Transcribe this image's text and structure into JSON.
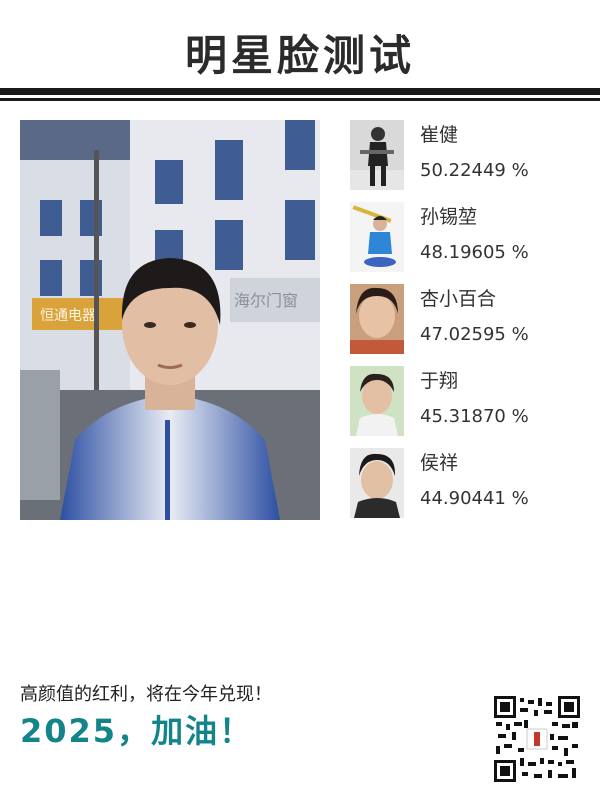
{
  "header": {
    "title": "明星脸测试"
  },
  "matches": [
    {
      "name": "崔健",
      "score": "50.22449 %"
    },
    {
      "name": "孙锡堃",
      "score": "48.19605 %"
    },
    {
      "name": "杏小百合",
      "score": "47.02595 %"
    },
    {
      "name": "于翔",
      "score": "45.31870 %"
    },
    {
      "name": "侯祥",
      "score": "44.90441 %"
    }
  ],
  "photo": {
    "shop_sign": "恒通电器",
    "shop_sign2": "海尔门窗"
  },
  "footer": {
    "slogan": "高颜值的红利，将在今年兑现！",
    "cheer": "2025，加油！"
  },
  "colors": {
    "accent": "#13848a",
    "rule": "#1a1a1a"
  },
  "icons": [
    "qr-code-icon"
  ]
}
